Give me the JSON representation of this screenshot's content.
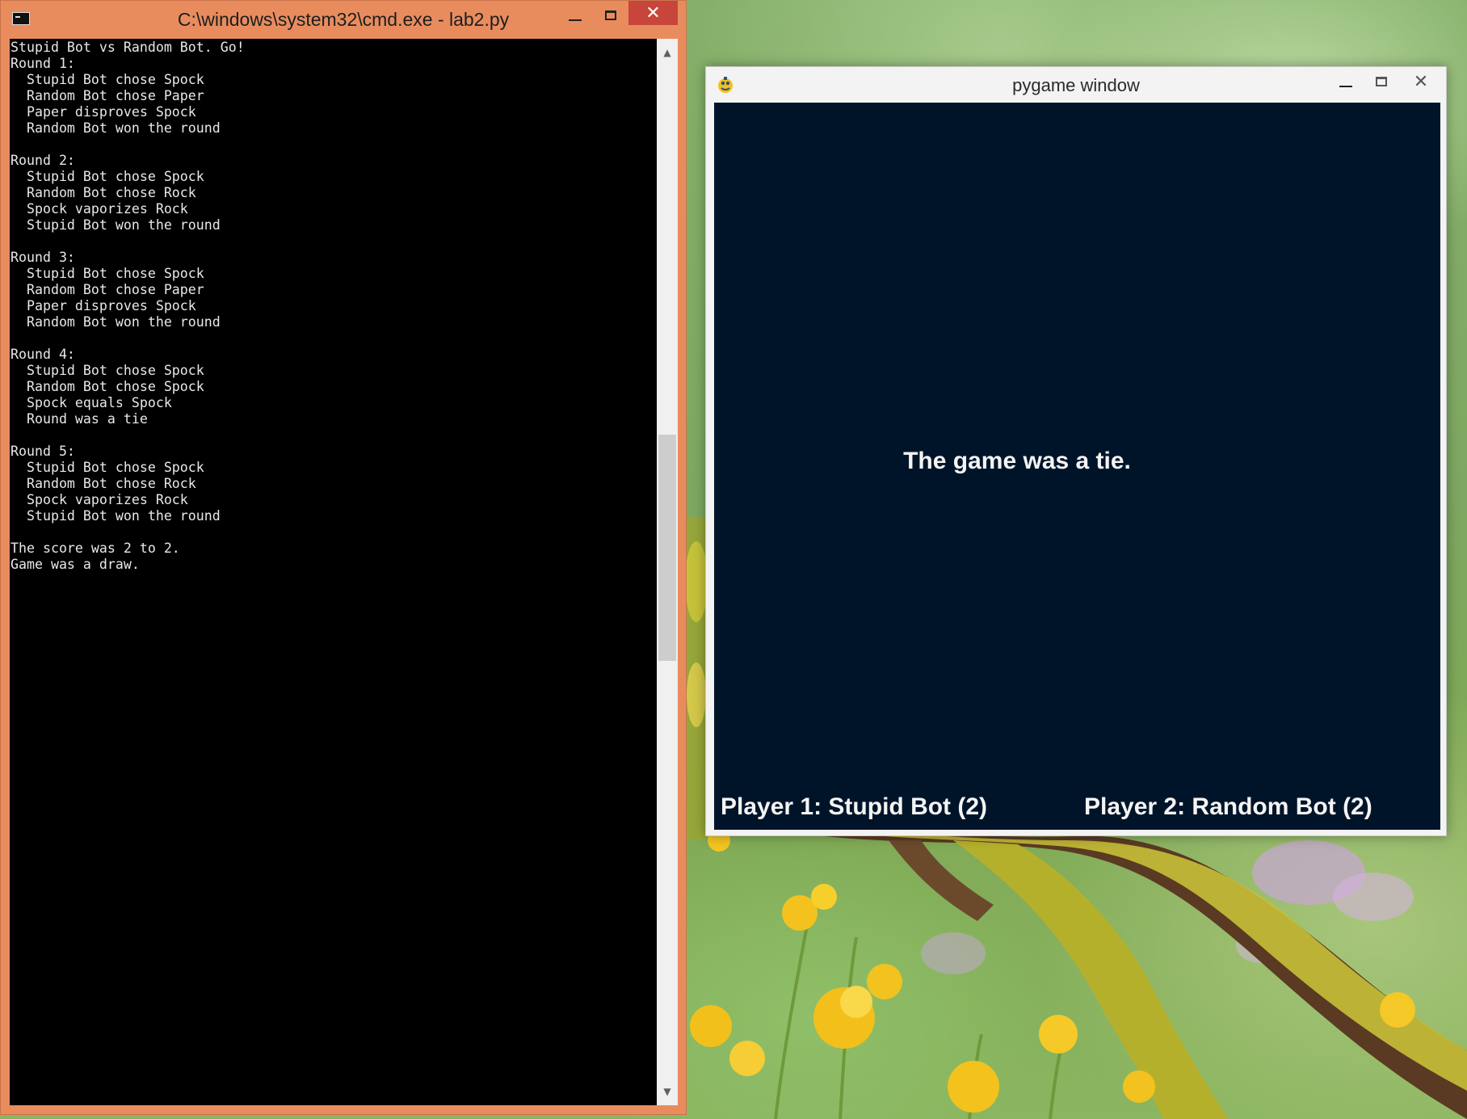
{
  "cmd_window": {
    "title": "C:\\windows\\system32\\cmd.exe - lab2.py",
    "icon": "console-icon",
    "controls": {
      "minimize": "minimize-icon",
      "maximize": "maximize-icon",
      "close": "✕"
    },
    "colors": {
      "frame": "#e88c5e",
      "close_button": "#c7453a",
      "console_bg": "#000000",
      "console_text": "#e8e8e8"
    },
    "output_lines": [
      "Stupid Bot vs Random Bot. Go!",
      "Round 1:",
      "  Stupid Bot chose Spock",
      "  Random Bot chose Paper",
      "  Paper disproves Spock",
      "  Random Bot won the round",
      "",
      "Round 2:",
      "  Stupid Bot chose Spock",
      "  Random Bot chose Rock",
      "  Spock vaporizes Rock",
      "  Stupid Bot won the round",
      "",
      "Round 3:",
      "  Stupid Bot chose Spock",
      "  Random Bot chose Paper",
      "  Paper disproves Spock",
      "  Random Bot won the round",
      "",
      "Round 4:",
      "  Stupid Bot chose Spock",
      "  Random Bot chose Spock",
      "  Spock equals Spock",
      "  Round was a tie",
      "",
      "Round 5:",
      "  Stupid Bot chose Spock",
      "  Random Bot chose Rock",
      "  Spock vaporizes Rock",
      "  Stupid Bot won the round",
      "",
      "The score was 2 to 2.",
      "Game was a draw."
    ],
    "scrollbar": {
      "up": "▲",
      "down": "▼"
    }
  },
  "pygame_window": {
    "title": "pygame window",
    "icon": "pygame-snake-icon",
    "controls": {
      "minimize": "minimize-icon",
      "maximize": "maximize-icon",
      "close": "✕"
    },
    "colors": {
      "canvas_bg": "#001429",
      "text": "#f4f4f4"
    },
    "result_text": "The game was a tie.",
    "player1_text": "Player 1: Stupid Bot (2)",
    "player2_text": "Player 2: Random Bot (2)"
  },
  "desktop": {
    "wallpaper": "mossy-branch-with-yellow-flowers"
  }
}
